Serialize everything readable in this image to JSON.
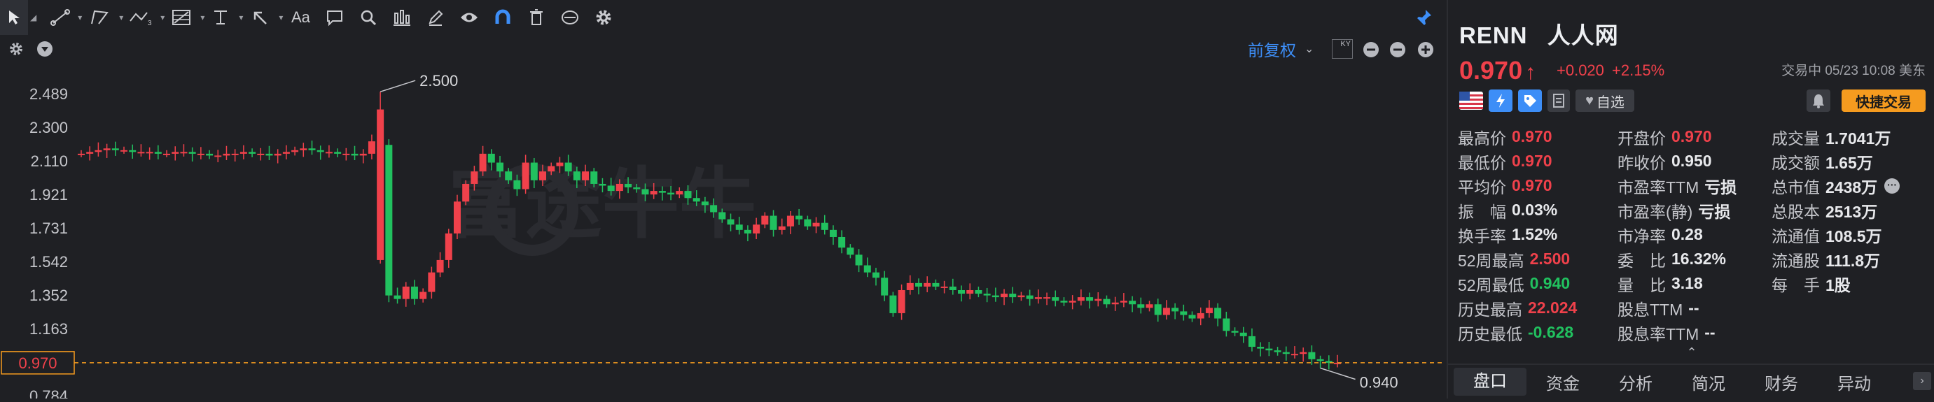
{
  "toolbar": {
    "tools": [
      "cursor",
      "trend-line",
      "polyline",
      "wave",
      "fib",
      "horizontal-line",
      "arrow",
      "text",
      "comment",
      "zoom",
      "measure",
      "pencil",
      "eye",
      "magnet",
      "trash",
      "sync",
      "settings"
    ]
  },
  "chartbar": {
    "adjust_label": "前复权",
    "ky_label": "KY"
  },
  "chart": {
    "y_ticks": [
      "2.489",
      "2.300",
      "2.110",
      "1.921",
      "1.731",
      "1.542",
      "1.352",
      "1.163",
      "0.970",
      "0.784"
    ],
    "high_label": "2.500",
    "low_label": "0.940",
    "current_price": "0.970",
    "watermark": "富途牛牛",
    "up_color": "#21c15f",
    "down_color": "#f0414b"
  },
  "chart_data": {
    "type": "candlestick",
    "ylim": [
      0.784,
      2.489
    ],
    "y_ticks": [
      2.489,
      2.3,
      2.11,
      1.921,
      1.731,
      1.542,
      1.352,
      1.163,
      0.97,
      0.784
    ],
    "annotations": [
      {
        "label": "2.500",
        "value": 2.5
      },
      {
        "label": "0.940",
        "value": 0.94
      }
    ],
    "current_price": 0.97,
    "close_series": [
      2.15,
      2.16,
      2.17,
      2.18,
      2.17,
      2.17,
      2.16,
      2.16,
      2.16,
      2.15,
      2.15,
      2.16,
      2.16,
      2.15,
      2.15,
      2.14,
      2.14,
      2.15,
      2.15,
      2.16,
      2.15,
      2.15,
      2.14,
      2.15,
      2.16,
      2.17,
      2.18,
      2.17,
      2.16,
      2.16,
      2.15,
      2.15,
      2.14,
      2.15,
      2.22,
      2.4,
      1.35,
      1.33,
      1.4,
      1.33,
      1.37,
      1.48,
      1.55,
      1.7,
      1.88,
      1.98,
      2.05,
      2.15,
      2.1,
      2.05,
      2.0,
      1.95,
      2.1,
      2.0,
      2.05,
      2.08,
      2.1,
      2.05,
      2.0,
      2.05,
      1.98,
      1.97,
      1.94,
      1.98,
      1.96,
      1.95,
      1.92,
      1.94,
      1.93,
      1.92,
      1.94,
      1.9,
      1.88,
      1.86,
      1.82,
      1.78,
      1.75,
      1.72,
      1.7,
      1.75,
      1.8,
      1.72,
      1.74,
      1.8,
      1.78,
      1.74,
      1.76,
      1.72,
      1.68,
      1.62,
      1.58,
      1.52,
      1.48,
      1.45,
      1.35,
      1.25,
      1.38,
      1.42,
      1.4,
      1.42,
      1.4,
      1.4,
      1.38,
      1.36,
      1.38,
      1.36,
      1.35,
      1.34,
      1.36,
      1.34,
      1.35,
      1.33,
      1.34,
      1.34,
      1.32,
      1.31,
      1.32,
      1.34,
      1.32,
      1.33,
      1.3,
      1.31,
      1.32,
      1.3,
      1.28,
      1.3,
      1.24,
      1.28,
      1.26,
      1.24,
      1.22,
      1.25,
      1.28,
      1.22,
      1.15,
      1.14,
      1.12,
      1.06,
      1.05,
      1.04,
      1.03,
      1.02,
      1.02,
      1.03,
      0.99,
      0.98,
      0.97,
      0.97
    ]
  },
  "quote": {
    "symbol": "RENN",
    "name": "人人网",
    "price": "0.970",
    "arrow": "↑",
    "change": "+0.020",
    "change_pct": "+2.15%",
    "status": "交易中 05/23 10:08 美东",
    "watchlist": "自选",
    "quick_trade": "快捷交易"
  },
  "stats": [
    {
      "label": "最高价",
      "value": "0.970",
      "color": "red"
    },
    {
      "label": "开盘价",
      "value": "0.970",
      "color": "red"
    },
    {
      "label": "成交量",
      "value": "1.7041万",
      "color": "white"
    },
    {
      "label": "最低价",
      "value": "0.970",
      "color": "red"
    },
    {
      "label": "昨收价",
      "value": "0.950",
      "color": "white"
    },
    {
      "label": "成交额",
      "value": "1.65万",
      "color": "white"
    },
    {
      "label": "平均价",
      "value": "0.970",
      "color": "red"
    },
    {
      "label": "市盈率TTM",
      "value": "亏损",
      "color": "white"
    },
    {
      "label": "总市值",
      "value": "2438万",
      "color": "white"
    },
    {
      "label": "振　幅",
      "value": "0.03%",
      "color": "white"
    },
    {
      "label": "市盈率(静)",
      "value": "亏损",
      "color": "white"
    },
    {
      "label": "总股本",
      "value": "2513万",
      "color": "white"
    },
    {
      "label": "换手率",
      "value": "1.52%",
      "color": "white"
    },
    {
      "label": "市净率",
      "value": "0.28",
      "color": "white"
    },
    {
      "label": "流通值",
      "value": "108.5万",
      "color": "white"
    },
    {
      "label": "52周最高",
      "value": "2.500",
      "color": "red"
    },
    {
      "label": "委　比",
      "value": "16.32%",
      "color": "white"
    },
    {
      "label": "流通股",
      "value": "111.8万",
      "color": "white"
    },
    {
      "label": "52周最低",
      "value": "0.940",
      "color": "green"
    },
    {
      "label": "量　比",
      "value": "3.18",
      "color": "white"
    },
    {
      "label": "每　手",
      "value": "1股",
      "color": "white"
    },
    {
      "label": "历史最高",
      "value": "22.024",
      "color": "red"
    },
    {
      "label": "股息TTM",
      "value": "--",
      "color": "white"
    },
    {
      "label": "",
      "value": "",
      "color": "white"
    },
    {
      "label": "历史最低",
      "value": "-0.628",
      "color": "green"
    },
    {
      "label": "股息率TTM",
      "value": "--",
      "color": "white"
    }
  ],
  "tabs": [
    "盘口",
    "资金",
    "分析",
    "简况",
    "财务",
    "异动"
  ]
}
